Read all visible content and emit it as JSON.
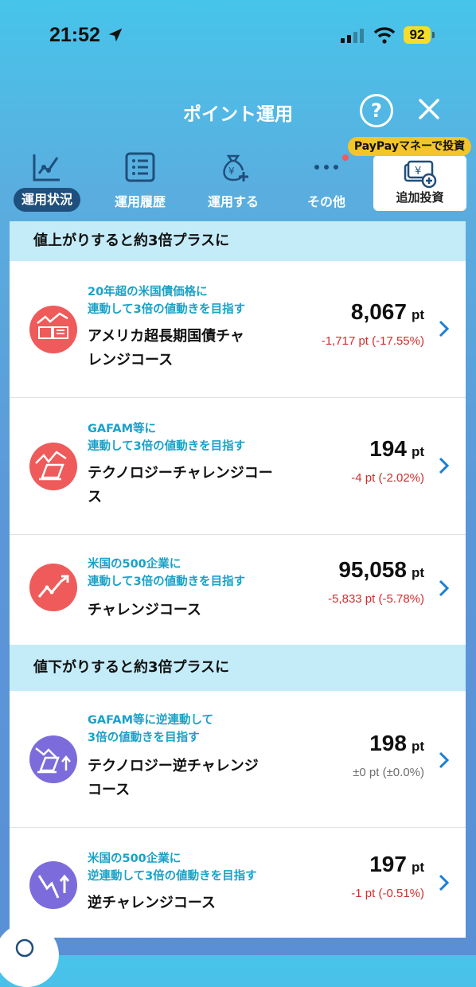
{
  "status": {
    "time": "21:52",
    "battery": "92"
  },
  "header": {
    "title": "ポイント運用",
    "help": "?"
  },
  "nav": {
    "items": [
      {
        "label": "運用状況",
        "icon": "chart-line-icon",
        "active": true
      },
      {
        "label": "運用履歴",
        "icon": "list-icon"
      },
      {
        "label": "運用する",
        "icon": "money-bag-plus-icon"
      },
      {
        "label": "その他",
        "icon": "more-dots-icon"
      }
    ],
    "promo_badge": "PayPayマネーで投資",
    "invest_button": "追加投資"
  },
  "sections": [
    {
      "header": "値上がりすると約3倍プラスに",
      "items": [
        {
          "desc": [
            "20年超の米国債価格に",
            "連動して3倍の値動きを目指す"
          ],
          "name": [
            "アメリカ超長期国債チャ",
            "レンジコース"
          ],
          "value": "8,067",
          "unit": "pt",
          "change": "-1,717 pt (-17.55%)",
          "icon": "bond-chart-icon"
        },
        {
          "desc": [
            "GAFAM等に",
            "連動して3倍の値動きを目指す"
          ],
          "name": [
            "テクノロジーチャレンジコー",
            "ス"
          ],
          "value": "194",
          "unit": "pt",
          "change": "-4 pt (-2.02%)",
          "icon": "laptop-chart-icon"
        },
        {
          "desc": [
            "米国の500企業に",
            "連動して3倍の値動きを目指す"
          ],
          "name": [
            "チャレンジコース"
          ],
          "value": "95,058",
          "unit": "pt",
          "change": "-5,833 pt (-5.78%)",
          "icon": "trend-up-icon"
        }
      ]
    },
    {
      "header": "値下がりすると約3倍プラスに",
      "items": [
        {
          "desc": [
            "GAFAM等に逆連動して",
            "3倍の値動きを目指す"
          ],
          "name": [
            "テクノロジー逆チャレンジ",
            "コース"
          ],
          "value": "198",
          "unit": "pt",
          "change": "±0 pt (±0.0%)",
          "icon": "laptop-inverse-icon"
        },
        {
          "desc": [
            "米国の500企業に",
            "逆連動して3倍の値動きを目指す"
          ],
          "name": [
            "逆チャレンジコース"
          ],
          "value": "197",
          "unit": "pt",
          "change": "-1 pt (-0.51%)",
          "icon": "trend-down-icon"
        }
      ]
    }
  ],
  "colors": {
    "accent_text": "#1aa1c8",
    "negative": "#d42d2d",
    "section_bg": "#c4ecf8",
    "nav_active_bg": "#1f4f7c",
    "promo_bg": "#f4c52b",
    "icon_red": "#ef5a5a",
    "icon_purple": "#7c6cdb"
  }
}
